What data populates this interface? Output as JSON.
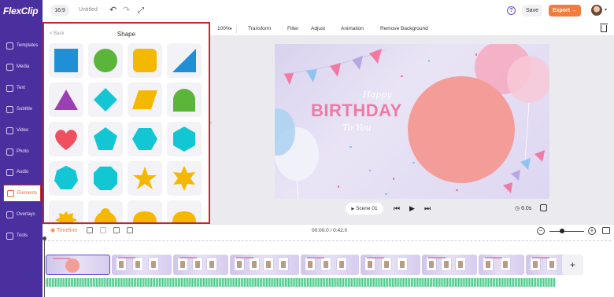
{
  "app": {
    "logo": "FlexClip",
    "accent": "#f57a3d",
    "sidebar_color": "#4a2f9e"
  },
  "topbar": {
    "ratio": "16:9",
    "title": "Untitled",
    "undo_icon": "undo-icon",
    "redo_icon": "redo-icon",
    "fullscreen_icon": "expand-icon",
    "help_label": "?",
    "save_label": "Save",
    "export_label": "Export →"
  },
  "sidebar": {
    "items": [
      {
        "label": "Templates"
      },
      {
        "label": "Media"
      },
      {
        "label": "Text"
      },
      {
        "label": "Subtitle"
      },
      {
        "label": "Video"
      },
      {
        "label": "Photo"
      },
      {
        "label": "Audio"
      },
      {
        "label": "Elements",
        "active": true
      },
      {
        "label": "Overlays"
      },
      {
        "label": "Tools"
      }
    ]
  },
  "panel": {
    "back_label": "< Back",
    "title": "Shape",
    "shapes": [
      {
        "name": "square",
        "color": "#1f8fd6"
      },
      {
        "name": "circle",
        "color": "#5bb53b"
      },
      {
        "name": "rounded-square",
        "color": "#f5b800"
      },
      {
        "name": "right-triangle",
        "color": "#1f8fd6"
      },
      {
        "name": "triangle",
        "color": "#9b3fb5"
      },
      {
        "name": "diamond",
        "color": "#13c6d4"
      },
      {
        "name": "parallelogram",
        "color": "#f5b800"
      },
      {
        "name": "arch",
        "color": "#5bb53b"
      },
      {
        "name": "heart",
        "color": "#ef4f5f"
      },
      {
        "name": "pentagon",
        "color": "#13c6d4"
      },
      {
        "name": "hexagon",
        "color": "#13c6d4"
      },
      {
        "name": "hexagon-vertical",
        "color": "#13c6d4"
      },
      {
        "name": "heptagon",
        "color": "#13c6d4"
      },
      {
        "name": "octagon",
        "color": "#13c6d4"
      },
      {
        "name": "star-5",
        "color": "#f5b800"
      },
      {
        "name": "star-6",
        "color": "#f5b800"
      },
      {
        "name": "burst-1",
        "color": "#f5b800"
      },
      {
        "name": "burst-2",
        "color": "#f5b800"
      },
      {
        "name": "burst-3",
        "color": "#f5b800"
      },
      {
        "name": "burst-4",
        "color": "#f5b800"
      }
    ]
  },
  "toolbar": {
    "zoom": "100%",
    "items": [
      "Transform",
      "Filter",
      "Adjust",
      "Animation",
      "Remove Background"
    ]
  },
  "canvas": {
    "happy": "Happy",
    "birthday": "BIRTHDAY",
    "to_you": "To You"
  },
  "scene_controls": {
    "scene_label": "Scene 01",
    "duration": "6.0s"
  },
  "timeline": {
    "label": "Timeline",
    "time": "00:00.0 / 0:42.0",
    "add_label": "+"
  }
}
